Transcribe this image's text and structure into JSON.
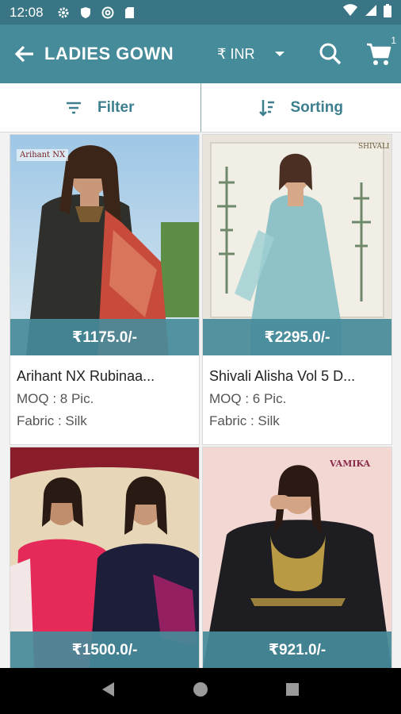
{
  "status_bar": {
    "time": "12:08",
    "icons": [
      "gear-icon",
      "shield-icon",
      "at-sign-icon",
      "sd-card-icon"
    ],
    "right_icons": [
      "wifi-icon",
      "signal-icon",
      "battery-icon"
    ]
  },
  "toolbar": {
    "title": "LADIES GOWN",
    "currency": "₹ INR",
    "cart_count": "1"
  },
  "filter_bar": {
    "filter_label": "Filter",
    "sorting_label": "Sorting"
  },
  "products": [
    {
      "price": "₹1175.0/-",
      "name": "Arihant NX Rubinaa...",
      "moq": "MOQ : 8 Pic.",
      "fabric": "Fabric : Silk",
      "brand": "Arihant NX"
    },
    {
      "price": "₹2295.0/-",
      "name": "Shivali Alisha Vol 5 D...",
      "moq": "MOQ : 6 Pic.",
      "fabric": "Fabric : Silk",
      "brand": "SHIVALI"
    },
    {
      "price": "₹1500.0/-",
      "name": "",
      "moq": "",
      "fabric": "",
      "brand": ""
    },
    {
      "price": "₹921.0/-",
      "name": "",
      "moq": "",
      "fabric": "",
      "brand": "VAMIKA"
    }
  ],
  "colors": {
    "status_bar": "#3a7585",
    "toolbar": "#468b9a",
    "accent": "#3d7f8e"
  }
}
